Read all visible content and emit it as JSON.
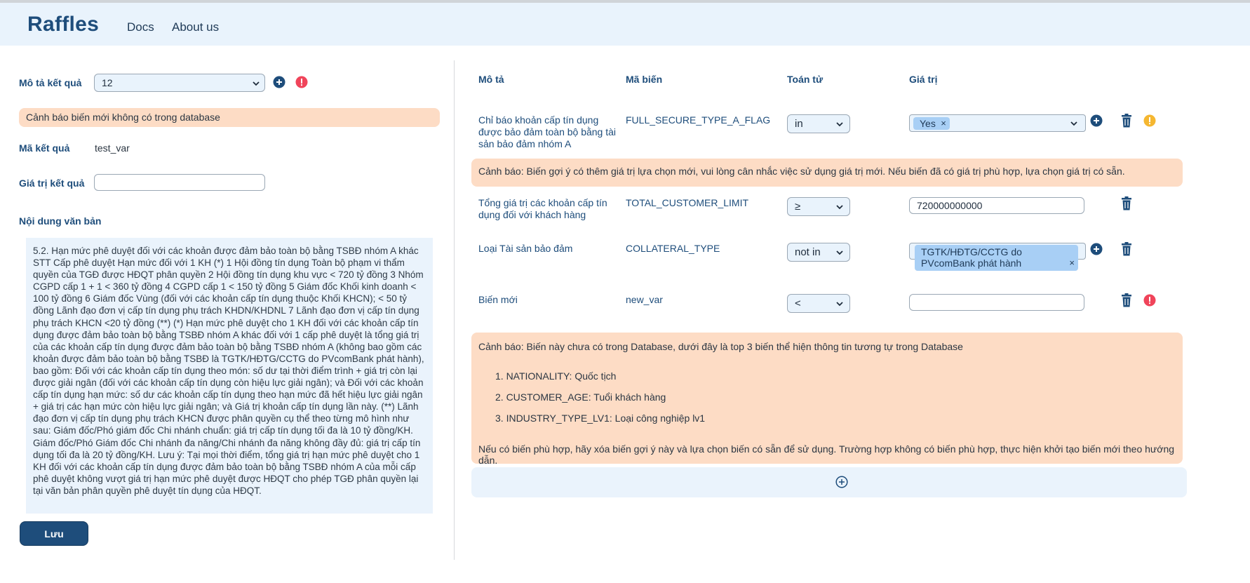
{
  "header": {
    "brand": "Raffles",
    "nav": [
      "Docs",
      "About us"
    ]
  },
  "left": {
    "result_desc_label": "Mô tả kết quả",
    "result_desc_value": "12",
    "warning": "Cảnh báo biến mới không có trong database",
    "result_code_label": "Mã kết quả",
    "result_code_value": "test_var",
    "result_value_label": "Giá trị kết quả",
    "result_value_input": "",
    "doc_content_label": "Nội dung văn bản",
    "doc_content": "5.2. Hạn mức phê duyệt đối với các khoản được đảm bảo toàn bộ bằng TSBĐ nhóm A khác STT Cấp phê duyệt Hạn mức đối với 1 KH (*) 1 Hội đồng tín dụng Toàn bộ phạm vi thẩm quyền của TGĐ được HĐQT phân quyền 2 Hội đồng tín dụng khu vực < 720 tỷ đồng 3 Nhóm CGPD cấp 1 + 1 < 360 tỷ đồng 4 CGPD cấp 1 < 150 tỷ đồng 5 Giám đốc Khối kinh doanh < 100 tỷ đồng 6 Giám đốc Vùng (đối với các khoản cấp tín dụng thuộc Khối KHCN); < 50 tỷ đồng Lãnh đạo đơn vị cấp tín dụng phụ trách KHDN/KHDNL 7 Lãnh đạo đơn vị cấp tín dụng phụ trách KHCN <20 tỷ đồng (**) (*) Hạn mức phê duyệt cho 1 KH đối với các khoản cấp tín dụng được đảm bảo toàn bộ bằng TSBĐ nhóm A khác đối với 1 cấp phê duyệt là tổng giá trị của các khoản cấp tín dụng được đảm bảo toàn bộ bằng TSBĐ nhóm A (không bao gồm các khoản được đảm bảo toàn bộ bằng TSBĐ là TGTK/HĐTG/CCTG do PVcomBank phát hành), bao gồm: Đối với các khoản cấp tín dụng theo món: số dư tại thời điểm trình + giá trị còn lại được giải ngân (đối với các khoản cấp tín dụng còn hiệu lực giải ngân); và Đối với các khoản cấp tín dụng hạn mức: số dư các khoản cấp tín dụng theo hạn mức đã hết hiệu lực giải ngân + giá trị các hạn mức còn hiệu lực giải ngân; và Giá trị khoản cấp tín dụng lần này. (**) Lãnh đạo đơn vị cấp tín dụng phụ trách KHCN được phân quyền cụ thể theo từng mô hình như sau: Giám đốc/Phó giám đốc Chi nhánh chuẩn: giá trị cấp tín dụng tối đa là 10 tỷ đồng/KH. Giám đốc/Phó Giám đốc Chi nhánh đa năng/Chi nhánh đa năng không đầy đủ: giá trị cấp tín dụng tối đa là 20 tỷ đồng/KH. Lưu ý: Tại mọi thời điểm, tổng giá trị hạn mức phê duyệt cho 1 KH đối với các khoản cấp tín dụng được đảm bảo toàn bộ bằng TSBĐ nhóm A của mỗi cấp phê duyệt không vượt giá trị hạn mức phê duyệt được HĐQT cho phép TGĐ phân quyền lại tại văn bản phân quyền phê duyệt tín dụng của HĐQT.",
    "save_label": "Lưu"
  },
  "table": {
    "headers": [
      "Mô tả",
      "Mã biến",
      "Toán tử",
      "Giá trị"
    ],
    "rows": [
      {
        "desc": "Chỉ báo khoản cấp tín dụng được bảo đảm toàn bộ bằng tài sản bảo đảm nhóm A",
        "code": "FULL_SECURE_TYPE_A_FLAG",
        "op": "in",
        "tags": [
          "Yes"
        ],
        "status": "warning"
      },
      {
        "desc": "Tổng giá trị các khoản cấp tín dụng đối với khách hàng",
        "code": "TOTAL_CUSTOMER_LIMIT",
        "op": "≥",
        "value": "720000000000"
      },
      {
        "desc": "Loại Tài sản bảo đảm",
        "code": "COLLATERAL_TYPE",
        "op": "not in",
        "tags": [
          "TGTK/HĐTG/CCTG do PVcomBank phát hành"
        ]
      },
      {
        "desc": "Biến mới",
        "code": "new_var",
        "op": "<",
        "value": "",
        "status": "error"
      }
    ],
    "warning_row1": "Cảnh báo: Biến gợi ý có thêm giá trị lựa chọn mới, vui lòng cân nhắc việc sử dụng giá trị mới. Nếu biến đã có giá trị phù hợp, lựa chọn giá trị có sẵn.",
    "warning_new_var": {
      "intro": "Cảnh báo: Biến này chưa có trong Database, dưới đây là top 3 biến thể hiện thông tin tương tự trong Database",
      "suggestions": [
        "1. NATIONALITY: Quốc tịch",
        "2. CUSTOMER_AGE: Tuổi khách hàng",
        "3. INDUSTRY_TYPE_LV1: Loại công nghiệp lv1"
      ],
      "outro": "Nếu có biến phù hợp, hãy xóa biến gợi ý này và lựa chọn biến có sẵn để sử dụng. Trường hợp không có biến phù hợp, thực hiện khởi tạo biến mới theo hướng dẫn."
    }
  },
  "colors": {
    "primary": "#1e4d7b",
    "header_bg": "#e9f3fc",
    "warning_bg": "#fddcc5",
    "tag_bg": "#a8cff5",
    "error": "#f0445a",
    "warning_icon": "#f5b731"
  },
  "icons": {
    "add": "plus-circle-icon",
    "delete": "trash-icon",
    "warn": "warning-circle-icon",
    "error": "error-circle-icon",
    "chevron": "chevron-down-icon",
    "tag_remove": "x-icon"
  }
}
